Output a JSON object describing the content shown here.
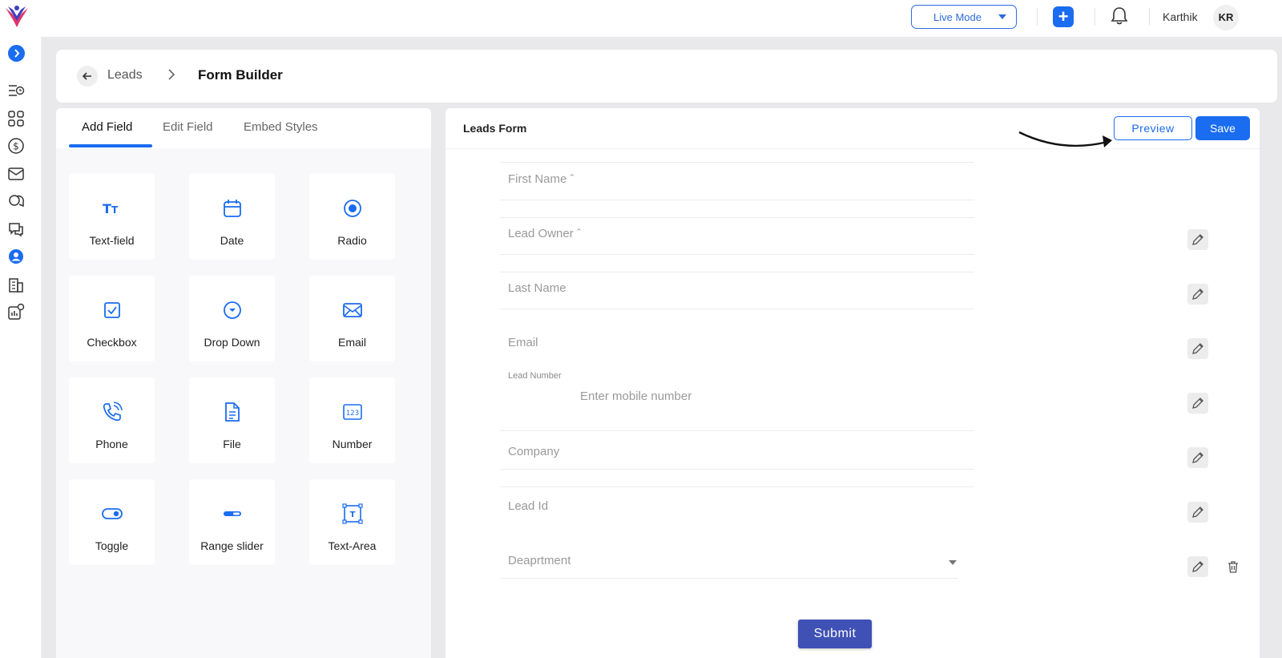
{
  "topbar": {
    "mode": "Live Mode",
    "user_name": "Karthik",
    "user_initials": "KR"
  },
  "breadcrumb": {
    "parent": "Leads",
    "current": "Form Builder"
  },
  "left_panel": {
    "tabs": [
      "Add Field",
      "Edit Field",
      "Embed Styles"
    ],
    "active_tab": "Add Field",
    "fields": [
      {
        "label": "Text-field",
        "icon": "text-field-icon"
      },
      {
        "label": "Date",
        "icon": "calendar-icon"
      },
      {
        "label": "Radio",
        "icon": "radio-icon"
      },
      {
        "label": "Checkbox",
        "icon": "checkbox-icon"
      },
      {
        "label": "Drop Down",
        "icon": "dropdown-icon"
      },
      {
        "label": "Email",
        "icon": "envelope-icon"
      },
      {
        "label": "Phone",
        "icon": "phone-icon"
      },
      {
        "label": "File",
        "icon": "file-icon"
      },
      {
        "label": "Number",
        "icon": "number-icon"
      },
      {
        "label": "Toggle",
        "icon": "toggle-icon"
      },
      {
        "label": "Range slider",
        "icon": "range-slider-icon"
      },
      {
        "label": "Text-Area",
        "icon": "text-area-icon"
      }
    ]
  },
  "form": {
    "title": "Leads Form",
    "preview_label": "Preview",
    "save_label": "Save",
    "fields": {
      "first_name": "First Name ˆ",
      "lead_owner": "Lead Owner ˆ",
      "last_name": "Last Name",
      "email": "Email",
      "lead_number_label": "Lead Number",
      "lead_number_placeholder": "Enter mobile number",
      "company": "Company",
      "lead_id": "Lead Id",
      "department": "Deaprtment"
    },
    "submit_label": "Submit"
  },
  "colors": {
    "primary": "#1a6cf0",
    "submit": "#3f51b5",
    "background": "#e9e9ec"
  }
}
